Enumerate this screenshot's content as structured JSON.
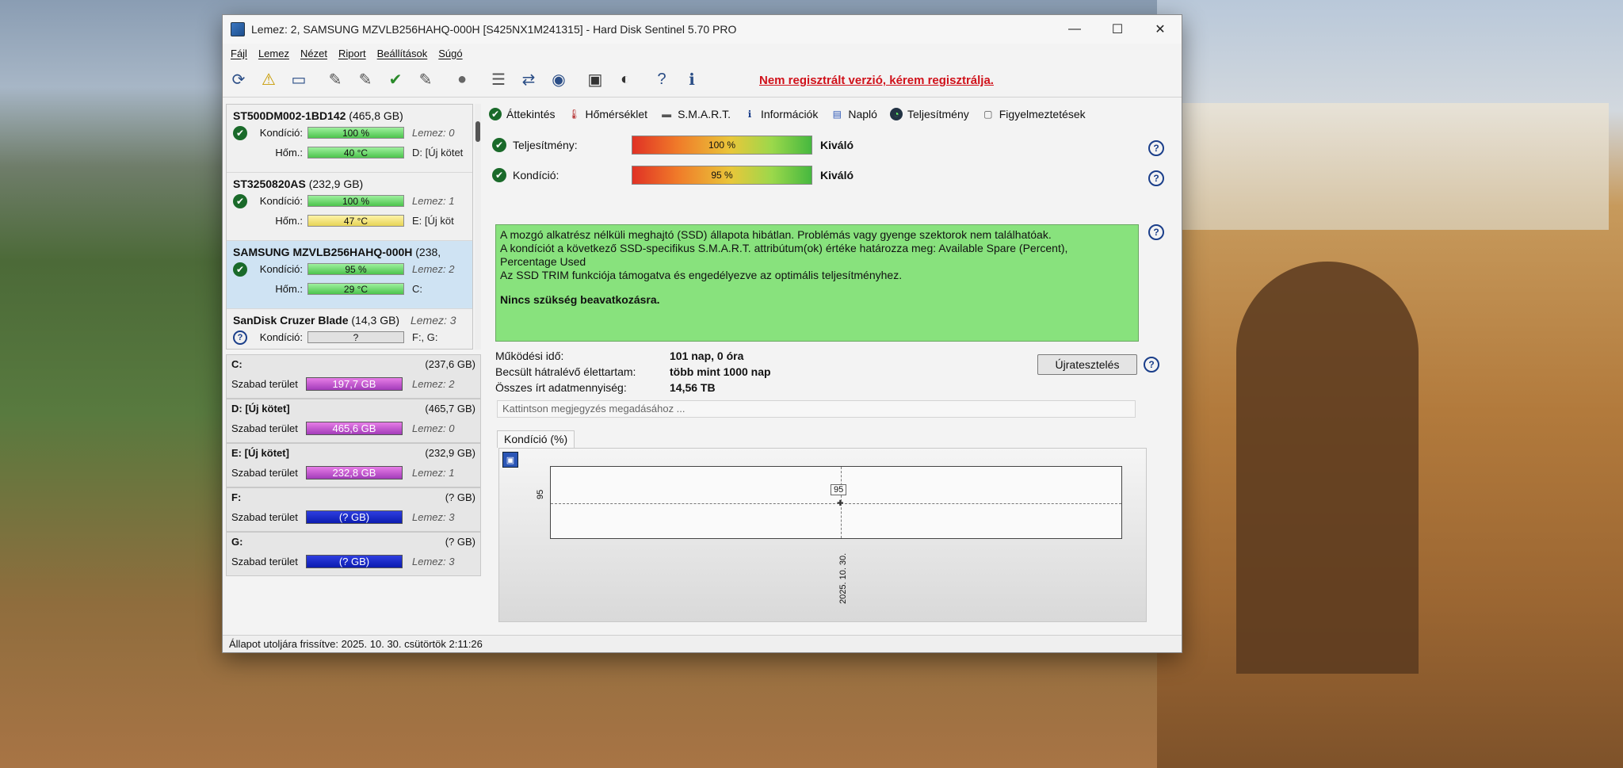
{
  "window": {
    "title": "Lemez: 2, SAMSUNG MZVLB256HAHQ-000H [S425NX1M241315]  -  Hard Disk Sentinel 5.70 PRO",
    "controls": {
      "minimize": "—",
      "maximize": "☐",
      "close": "✕"
    }
  },
  "menu": [
    "Fájl",
    "Lemez",
    "Nézet",
    "Riport",
    "Beállítások",
    "Súgó"
  ],
  "toolbar": {
    "unregistered": "Nem regisztrált verzió, kérem regisztrálja.",
    "icons": [
      "refresh-icon",
      "warning-icon",
      "disk-icon",
      "tool-icon",
      "tool-check-icon",
      "tool-ok-icon",
      "tool-x-icon",
      "blob-icon",
      "report-icon",
      "sync-icon",
      "network-icon",
      "monitor-icon",
      "speaker-icon",
      "help-icon",
      "info-icon"
    ]
  },
  "disks": [
    {
      "name": "ST500DM002-1BD142",
      "size": "(465,8 GB)",
      "cond_label": "Kondíció:",
      "cond": "100 %",
      "cond_info": "Lemez: 0",
      "temp_label": "Hőm.:",
      "temp": "40 °C",
      "temp_info": "D: [Új kötet",
      "status": "ok",
      "temp_color": "green",
      "cond_color": "green"
    },
    {
      "name": "ST3250820AS",
      "size": "(232,9 GB)",
      "cond_label": "Kondíció:",
      "cond": "100 %",
      "cond_info": "Lemez: 1",
      "temp_label": "Hőm.:",
      "temp": "47 °C",
      "temp_info": "E: [Új köt",
      "status": "ok",
      "temp_color": "yellow",
      "cond_color": "green"
    },
    {
      "name": "SAMSUNG MZVLB256HAHQ-000H",
      "size": "(238,",
      "cond_label": "Kondíció:",
      "cond": "95 %",
      "cond_info": "Lemez: 2",
      "temp_label": "Hőm.:",
      "temp": "29 °C",
      "temp_info": "C:",
      "status": "ok",
      "temp_color": "green",
      "cond_color": "green"
    },
    {
      "name": "SanDisk Cruzer Blade",
      "size": "(14,3 GB)",
      "cond_label": "Kondíció:",
      "cond": "?",
      "cond_info": "F:, G:",
      "extra_info": "Lemez: 3",
      "status": "unknown",
      "cond_color": "gray"
    }
  ],
  "volumes": [
    {
      "name": "C:",
      "size": "(237,6 GB)",
      "free_label": "Szabad terület",
      "free": "197,7 GB",
      "disk": "Lemez: 2",
      "color": "mag"
    },
    {
      "name": "D: [Új kötet]",
      "size": "(465,7 GB)",
      "free_label": "Szabad terület",
      "free": "465,6 GB",
      "disk": "Lemez: 0",
      "color": "mag"
    },
    {
      "name": "E: [Új kötet]",
      "size": "(232,9 GB)",
      "free_label": "Szabad terület",
      "free": "232,8 GB",
      "disk": "Lemez: 1",
      "color": "mag"
    },
    {
      "name": "F:",
      "size": "(? GB)",
      "free_label": "Szabad terület",
      "free": "(? GB)",
      "disk": "Lemez: 3",
      "color": "blue"
    },
    {
      "name": "G:",
      "size": "(? GB)",
      "free_label": "Szabad terület",
      "free": "(? GB)",
      "disk": "Lemez: 3",
      "color": "blue"
    }
  ],
  "tabs": [
    "Áttekintés",
    "Hőmérséklet",
    "S.M.A.R.T.",
    "Információk",
    "Napló",
    "Teljesítmény",
    "Figyelmeztetések"
  ],
  "overview": {
    "perf_label": "Teljesítmény:",
    "perf_value": "100 %",
    "perf_word": "Kiváló",
    "cond_label": "Kondíció:",
    "cond_value": "95 %",
    "cond_word": "Kiváló",
    "message_lines": [
      "A mozgó alkatrész nélküli meghajtó (SSD) állapota hibátlan. Problémás vagy gyenge szektorok nem találhatóak.",
      "A kondíciót a következő SSD-specifikus S.M.A.R.T. attribútum(ok) értéke határozza meg:  Available Spare (Percent),",
      "Percentage Used",
      "Az SSD TRIM funkciója támogatva és engedélyezve az optimális teljesítményhez."
    ],
    "message_strong": "Nincs szükség beavatkozásra.",
    "stats": [
      {
        "k": "Működési idő:",
        "v": "101 nap, 0 óra"
      },
      {
        "k": "Becsült hátralévő élettartam:",
        "v": "több mint 1000 nap"
      },
      {
        "k": "Összes írt adatmennyiség:",
        "v": "14,56 TB"
      }
    ],
    "restart_button": "Újratesztelés",
    "note_placeholder": "Kattintson megjegyzés megadásához ..."
  },
  "chart_tab": "Kondíció  (%)",
  "chart_data": {
    "type": "line",
    "x": [
      "2025. 10. 30."
    ],
    "series": [
      {
        "values": [
          95
        ]
      }
    ],
    "yticks": [
      "95"
    ],
    "point_label": "95"
  },
  "statusbar": "Állapot utoljára frissítve: 2025. 10. 30. csütörtök 2:11:26"
}
